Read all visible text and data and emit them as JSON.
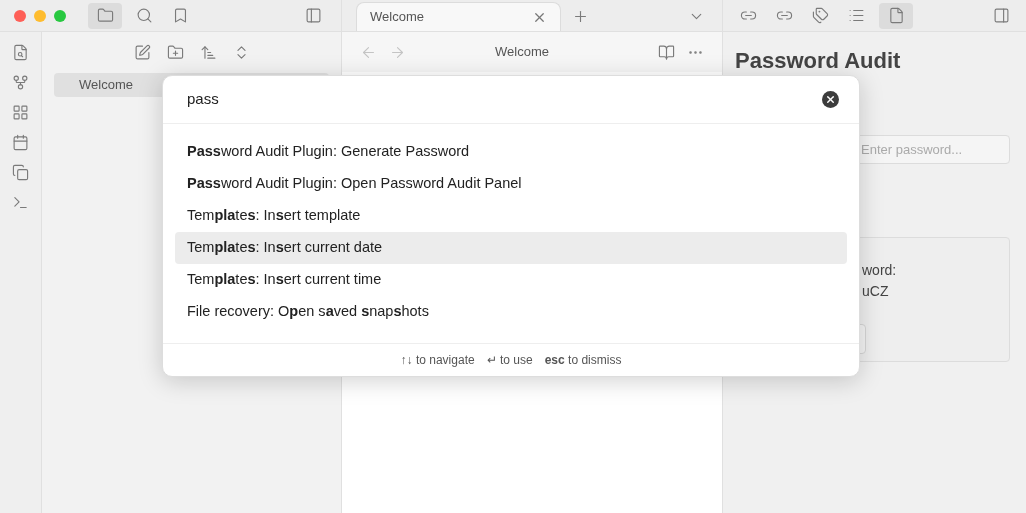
{
  "file_explorer": {
    "items": [
      {
        "label": "Welcome",
        "selected": true
      }
    ]
  },
  "tabs": [
    {
      "label": "Welcome",
      "selected": true
    }
  ],
  "editor": {
    "title": "Welcome"
  },
  "right_panel": {
    "heading": "Password Audit",
    "password_field": {
      "placeholder": "Enter password..."
    },
    "result_lines": [
      "word:",
      "uCZ"
    ]
  },
  "command_palette": {
    "query": "pass",
    "results": [
      {
        "text": "**Pass**word Audit Plugin: Generate Password",
        "selected": false
      },
      {
        "text": "**Pass**word Audit Plugin: Open Password Audit Panel",
        "selected": false
      },
      {
        "text": "Tem**pla**te**s**: In**s**ert template",
        "selected": false
      },
      {
        "text": "Tem**pla**te**s**: In**s**ert current date",
        "selected": true
      },
      {
        "text": "Tem**pla**te**s**: In**s**ert current time",
        "selected": false
      },
      {
        "text": "File recovery: O**p**en s**a**ved **s**nap**s**hots",
        "selected": false
      }
    ],
    "hints": [
      {
        "key": "↑↓",
        "label": "to navigate"
      },
      {
        "key": "↵",
        "label": "to use"
      },
      {
        "key": "**esc**",
        "label": "to dismiss"
      }
    ]
  }
}
